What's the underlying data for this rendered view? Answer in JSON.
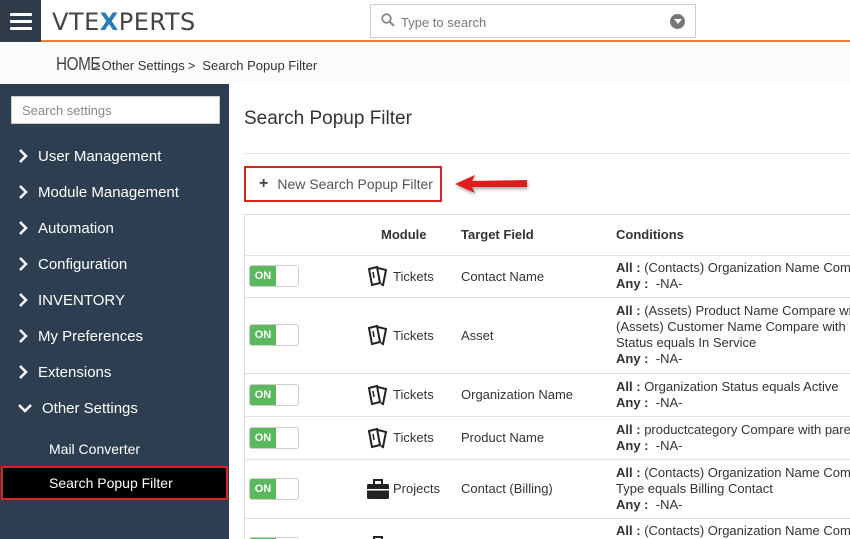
{
  "header": {
    "logo_prefix": "VTE",
    "logo_x": "X",
    "logo_suffix": "PERTS",
    "search_placeholder": "Type to search"
  },
  "breadcrumb": {
    "home": "HOME",
    "sep1": ">",
    "item1": "Other Settings",
    "sep2": ">",
    "item2": "Search Popup Filter"
  },
  "sidebar": {
    "search_placeholder": "Search settings",
    "items": [
      {
        "label": "User Management"
      },
      {
        "label": "Module Management"
      },
      {
        "label": "Automation"
      },
      {
        "label": "Configuration"
      },
      {
        "label": "INVENTORY"
      },
      {
        "label": "My Preferences"
      },
      {
        "label": "Extensions"
      },
      {
        "label": "Other Settings"
      }
    ],
    "subitems": [
      {
        "label": "Mail Converter"
      },
      {
        "label": "Search Popup Filter"
      }
    ]
  },
  "main": {
    "title": "Search Popup Filter",
    "new_button": "New Search Popup Filter",
    "columns": {
      "module": "Module",
      "target_field": "Target Field",
      "conditions": "Conditions"
    },
    "toggle_on": "ON",
    "all_label": "All :",
    "any_label": "Any :",
    "rows": [
      {
        "module": "Tickets",
        "target": "Contact Name",
        "all": [
          "(Contacts) Organization Name Com"
        ],
        "any": "-NA-"
      },
      {
        "module": "Tickets",
        "target": "Asset",
        "all": [
          "(Assets) Product Name Compare wi",
          "(Assets) Customer Name Compare with p",
          "Status equals In Service"
        ],
        "any": "-NA-"
      },
      {
        "module": "Tickets",
        "target": "Organization Name",
        "all": [
          "Organization Status equals Active"
        ],
        "any": "-NA-"
      },
      {
        "module": "Tickets",
        "target": "Product Name",
        "all": [
          "productcategory Compare with pare"
        ],
        "any": "-NA-"
      },
      {
        "module": "Projects",
        "target": "Contact (Billing)",
        "all": [
          "(Contacts) Organization Name Com",
          "Type equals Billing Contact"
        ],
        "any": "-NA-"
      },
      {
        "module": "",
        "target": "",
        "all": [
          "(Contacts) Organization Name Com"
        ],
        "any": ""
      }
    ]
  }
}
